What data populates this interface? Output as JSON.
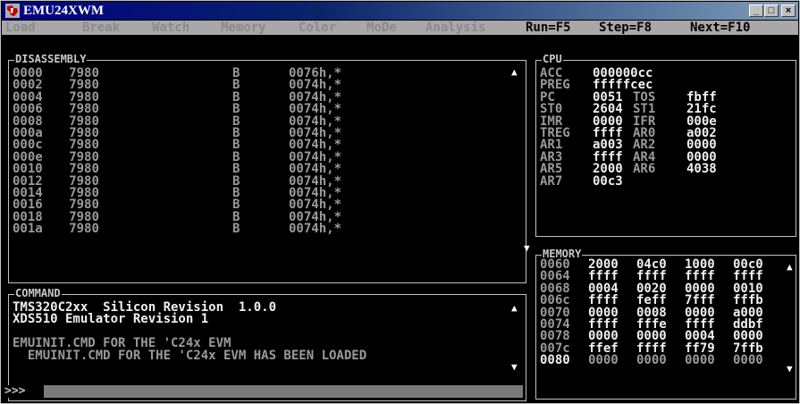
{
  "window": {
    "title": "EMU24XWM",
    "minimize": "_",
    "maximize": "□",
    "close": "×"
  },
  "menu": [
    {
      "label": "Load"
    },
    {
      "label": "Break"
    },
    {
      "label": "Watch"
    },
    {
      "label": "Memory"
    },
    {
      "label": "Color"
    },
    {
      "label": "MoDe"
    },
    {
      "label": "Analysis"
    },
    {
      "label": "Run=F5"
    },
    {
      "label": "Step=F8"
    },
    {
      "label": "Next=F10"
    }
  ],
  "disassembly": {
    "title": "DISASSEMBLY",
    "rows": [
      {
        "addr": "0000",
        "op": "7980",
        "mn": "B",
        "arg": "0076h,*"
      },
      {
        "addr": "0002",
        "op": "7980",
        "mn": "B",
        "arg": "0074h,*"
      },
      {
        "addr": "0004",
        "op": "7980",
        "mn": "B",
        "arg": "0074h,*"
      },
      {
        "addr": "0006",
        "op": "7980",
        "mn": "B",
        "arg": "0074h,*"
      },
      {
        "addr": "0008",
        "op": "7980",
        "mn": "B",
        "arg": "0074h,*"
      },
      {
        "addr": "000a",
        "op": "7980",
        "mn": "B",
        "arg": "0074h,*"
      },
      {
        "addr": "000c",
        "op": "7980",
        "mn": "B",
        "arg": "0074h,*"
      },
      {
        "addr": "000e",
        "op": "7980",
        "mn": "B",
        "arg": "0074h,*"
      },
      {
        "addr": "0010",
        "op": "7980",
        "mn": "B",
        "arg": "0074h,*"
      },
      {
        "addr": "0012",
        "op": "7980",
        "mn": "B",
        "arg": "0074h,*"
      },
      {
        "addr": "0014",
        "op": "7980",
        "mn": "B",
        "arg": "0074h,*"
      },
      {
        "addr": "0016",
        "op": "7980",
        "mn": "B",
        "arg": "0074h,*"
      },
      {
        "addr": "0018",
        "op": "7980",
        "mn": "B",
        "arg": "0074h,*"
      },
      {
        "addr": "001a",
        "op": "7980",
        "mn": "B",
        "arg": "0074h,*"
      }
    ]
  },
  "cpu": {
    "title": "CPU",
    "rows": [
      [
        "ACC",
        "000000cc",
        "",
        ""
      ],
      [
        "PREG",
        "fffffcec",
        "",
        ""
      ],
      [
        "PC",
        "0051",
        "TOS",
        "fbff"
      ],
      [
        "ST0",
        "2604",
        "ST1",
        "21fc"
      ],
      [
        "IMR",
        "0000",
        "IFR",
        "000e"
      ],
      [
        "TREG",
        "ffff",
        "AR0",
        "a002"
      ],
      [
        "AR1",
        "a003",
        "AR2",
        "0000"
      ],
      [
        "AR3",
        "ffff",
        "AR4",
        "0000"
      ],
      [
        "AR5",
        "2000",
        "AR6",
        "4038"
      ],
      [
        "AR7",
        "00c3",
        "",
        ""
      ]
    ]
  },
  "memory": {
    "title": "MEMORY",
    "rows": [
      [
        "0060",
        "2000",
        "04c0",
        "1000",
        "00c0"
      ],
      [
        "0064",
        "ffff",
        "ffff",
        "ffff",
        "ffff"
      ],
      [
        "0068",
        "0004",
        "0020",
        "0000",
        "0010"
      ],
      [
        "006c",
        "ffff",
        "feff",
        "7fff",
        "fffb"
      ],
      [
        "0070",
        "0000",
        "0008",
        "0000",
        "a000"
      ],
      [
        "0074",
        "ffff",
        "fffe",
        "ffff",
        "ddbf"
      ],
      [
        "0078",
        "0000",
        "0000",
        "0004",
        "0000"
      ],
      [
        "007c",
        "ffef",
        "ffff",
        "ff79",
        "7ffb"
      ],
      [
        "0080",
        "0000",
        "0000",
        "0000",
        "0000"
      ]
    ]
  },
  "command": {
    "title": "COMMAND",
    "lines": [
      "TMS320C2xx  Silicon Revision  1.0.0",
      "XDS510 Emulator Revision 1",
      "",
      "EMUINIT.CMD FOR THE 'C24x EVM",
      "  EMUINIT.CMD FOR THE 'C24x EVM HAS BEEN LOADED"
    ],
    "prompt": ">>>",
    "input": ""
  },
  "colors": {
    "titlebar": "#000080",
    "menubar": "#a8a8a8",
    "text_dim": "#9a9a9a",
    "text_bright": "#f0f0f0"
  }
}
